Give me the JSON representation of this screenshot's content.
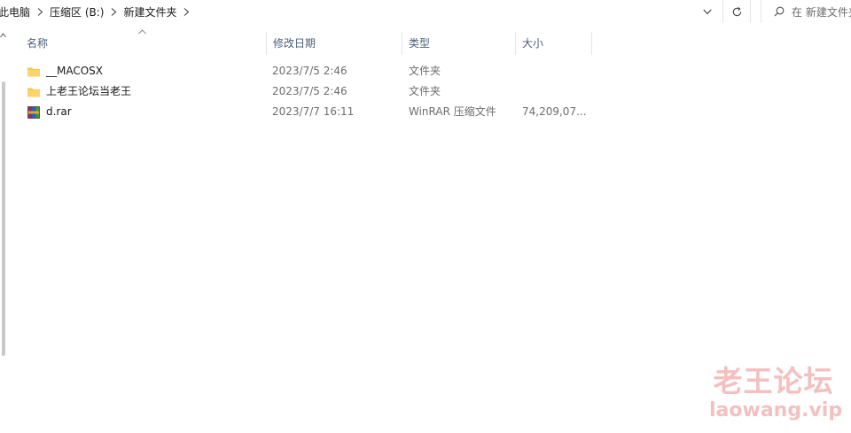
{
  "address_bar": {
    "breadcrumbs": [
      "此电脑",
      "压缩区 (B:)",
      "新建文件夹"
    ]
  },
  "search": {
    "placeholder": "在 新建文件夹"
  },
  "columns": {
    "name": "名称",
    "date": "修改日期",
    "type": "类型",
    "size": "大小"
  },
  "files": [
    {
      "name": "__MACOSX",
      "date": "2023/7/5 2:46",
      "type": "文件夹",
      "size": "",
      "icon": "folder-icon"
    },
    {
      "name": "上老王论坛当老王",
      "date": "2023/7/5 2:46",
      "type": "文件夹",
      "size": "",
      "icon": "folder-icon"
    },
    {
      "name": "d.rar",
      "date": "2023/7/7 16:11",
      "type": "WinRAR 压缩文件",
      "size": "74,209,07...",
      "icon": "winrar-archive-icon"
    }
  ],
  "watermark": {
    "title": "老王论坛",
    "url": "laowang.vip"
  },
  "colors": {
    "header_text": "#4c607a",
    "folder": "#f8c64a",
    "watermark": "#f4c0bf"
  }
}
